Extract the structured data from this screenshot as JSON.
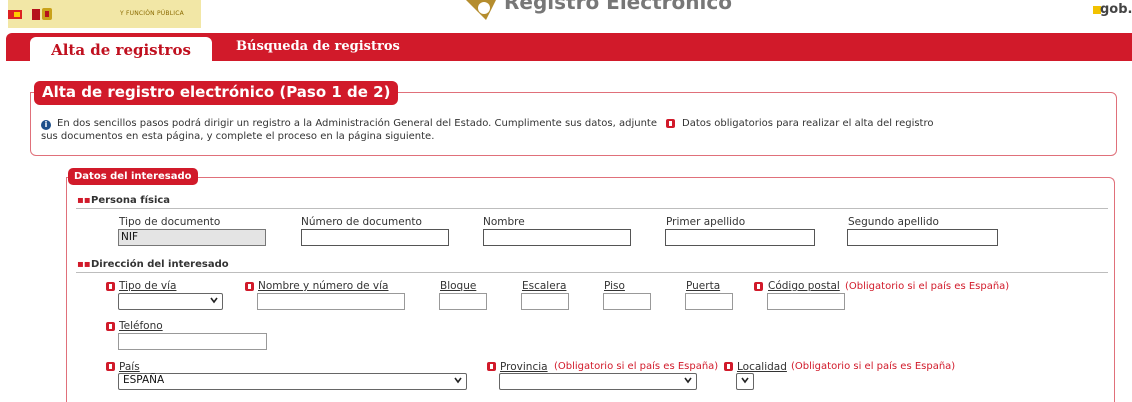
{
  "header": {
    "gov_text": "Y FUNCIÓN PÚBLICA",
    "app_title": "Registro Electrónico",
    "gob_es": "gob.es"
  },
  "tabs": [
    {
      "label": "Alta de registros",
      "active": true
    },
    {
      "label": "Búsqueda de registros",
      "active": false
    }
  ],
  "panel": {
    "title": "Alta de registro electrónico (Paso 1 de 2)",
    "intro_line1": "En dos sencillos pasos podrá dirigir un registro a la Administración General del Estado. Cumplimente sus datos, adjunte",
    "intro_line2": "sus documentos en esta página, y complete el proceso en la página siguiente.",
    "required_legend": "Datos obligatorios para realizar el alta del registro"
  },
  "interesado": {
    "title": "Datos del interesado",
    "persona_fisica": {
      "heading": "Persona física",
      "tipo_documento": {
        "label": "Tipo de documento",
        "value": "NIF"
      },
      "numero_documento": {
        "label": "Número de documento",
        "value": ""
      },
      "nombre": {
        "label": "Nombre",
        "value": ""
      },
      "primer_apellido": {
        "label": "Primer apellido",
        "value": ""
      },
      "segundo_apellido": {
        "label": "Segundo apellido",
        "value": ""
      }
    },
    "direccion": {
      "heading": "Dirección del interesado",
      "tipo_via": {
        "label": "Tipo de vía",
        "value": ""
      },
      "nombre_via": {
        "label": "Nombre y número de vía",
        "value": ""
      },
      "bloque": {
        "label": "Bloque",
        "value": ""
      },
      "escalera": {
        "label": "Escalera",
        "value": ""
      },
      "piso": {
        "label": "Piso",
        "value": ""
      },
      "puerta": {
        "label": "Puerta",
        "value": ""
      },
      "codigo_postal": {
        "label": "Código postal",
        "note": "(Obligatorio si el país es España)",
        "value": ""
      },
      "telefono": {
        "label": "Teléfono",
        "value": ""
      },
      "pais": {
        "label": "País",
        "value": "ESPAÑA"
      },
      "provincia": {
        "label": "Provincia",
        "note": "(Obligatorio si el país es España)",
        "value": ""
      },
      "localidad": {
        "label": "Localidad",
        "note": "(Obligatorio si el país es España)",
        "value": ""
      }
    }
  },
  "colors": {
    "brand_red": "#d11a2a",
    "info_blue": "#1d4f8a"
  }
}
